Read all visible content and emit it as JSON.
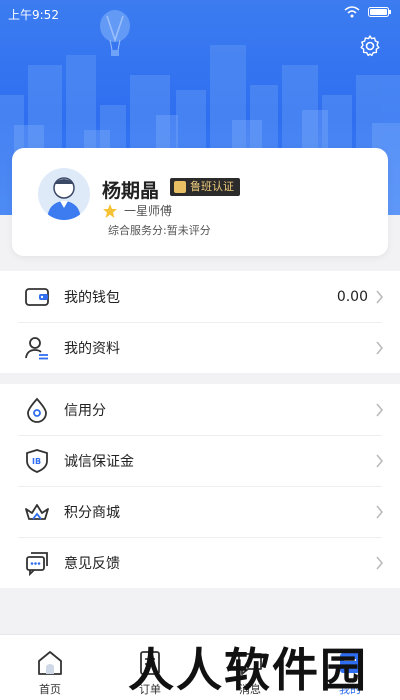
{
  "status_bar": {
    "time": "上午9:52"
  },
  "profile": {
    "name": "杨期晶",
    "certification": "鲁班认证",
    "level": "一星师傅",
    "service_score": "综合服务分:暂未评分"
  },
  "wallet": {
    "label": "我的钱包",
    "value": "0.00"
  },
  "account_items": [
    {
      "label": "我的资料",
      "icon": "profile-icon"
    }
  ],
  "service_items": [
    {
      "label": "信用分",
      "icon": "credit-drop-icon"
    },
    {
      "label": "诚信保证金",
      "icon": "shield-icon"
    },
    {
      "label": "积分商城",
      "icon": "crown-icon"
    },
    {
      "label": "意见反馈",
      "icon": "feedback-icon"
    }
  ],
  "tabs": [
    {
      "label": "首页",
      "icon": "home-icon"
    },
    {
      "label": "订单",
      "icon": "order-icon"
    },
    {
      "label": "消息",
      "icon": "message-icon"
    },
    {
      "label": "我的",
      "icon": "mine-icon",
      "active": true
    }
  ],
  "watermark": "人人软件园",
  "colors": {
    "primary": "#2f6ef0",
    "background": "#f2f2f4",
    "badge_bg": "#2b2b2b",
    "badge_text": "#f0cc7c"
  }
}
